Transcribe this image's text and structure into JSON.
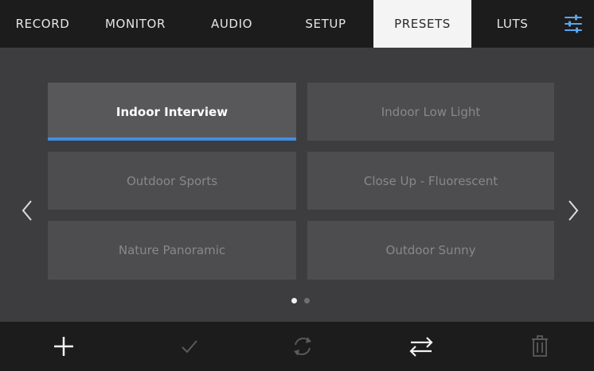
{
  "tabs": [
    {
      "label": "RECORD",
      "active": false
    },
    {
      "label": "MONITOR",
      "active": false
    },
    {
      "label": "AUDIO",
      "active": false
    },
    {
      "label": "SETUP",
      "active": false
    },
    {
      "label": "PRESETS",
      "active": true
    },
    {
      "label": "LUTS",
      "active": false
    }
  ],
  "settings_icon": "sliders-icon",
  "presets": [
    {
      "label": "Indoor Interview",
      "selected": true
    },
    {
      "label": "Indoor Low Light",
      "selected": false
    },
    {
      "label": "Outdoor Sports",
      "selected": false
    },
    {
      "label": "Close Up - Fluorescent",
      "selected": false
    },
    {
      "label": "Nature Panoramic",
      "selected": false
    },
    {
      "label": "Outdoor Sunny",
      "selected": false
    }
  ],
  "pagination": {
    "current_page": 1,
    "total_pages": 2
  },
  "toolbar": [
    {
      "icon": "plus-icon",
      "enabled": true
    },
    {
      "icon": "checkmark-icon",
      "enabled": false
    },
    {
      "icon": "refresh-icon",
      "enabled": false
    },
    {
      "icon": "swap-arrows-icon",
      "enabled": true
    },
    {
      "icon": "trash-icon",
      "enabled": false
    }
  ],
  "colors": {
    "accent": "#3e8fe0",
    "tab_active_bg": "#f4f4f4",
    "bar_bg": "#1c1c1d"
  }
}
